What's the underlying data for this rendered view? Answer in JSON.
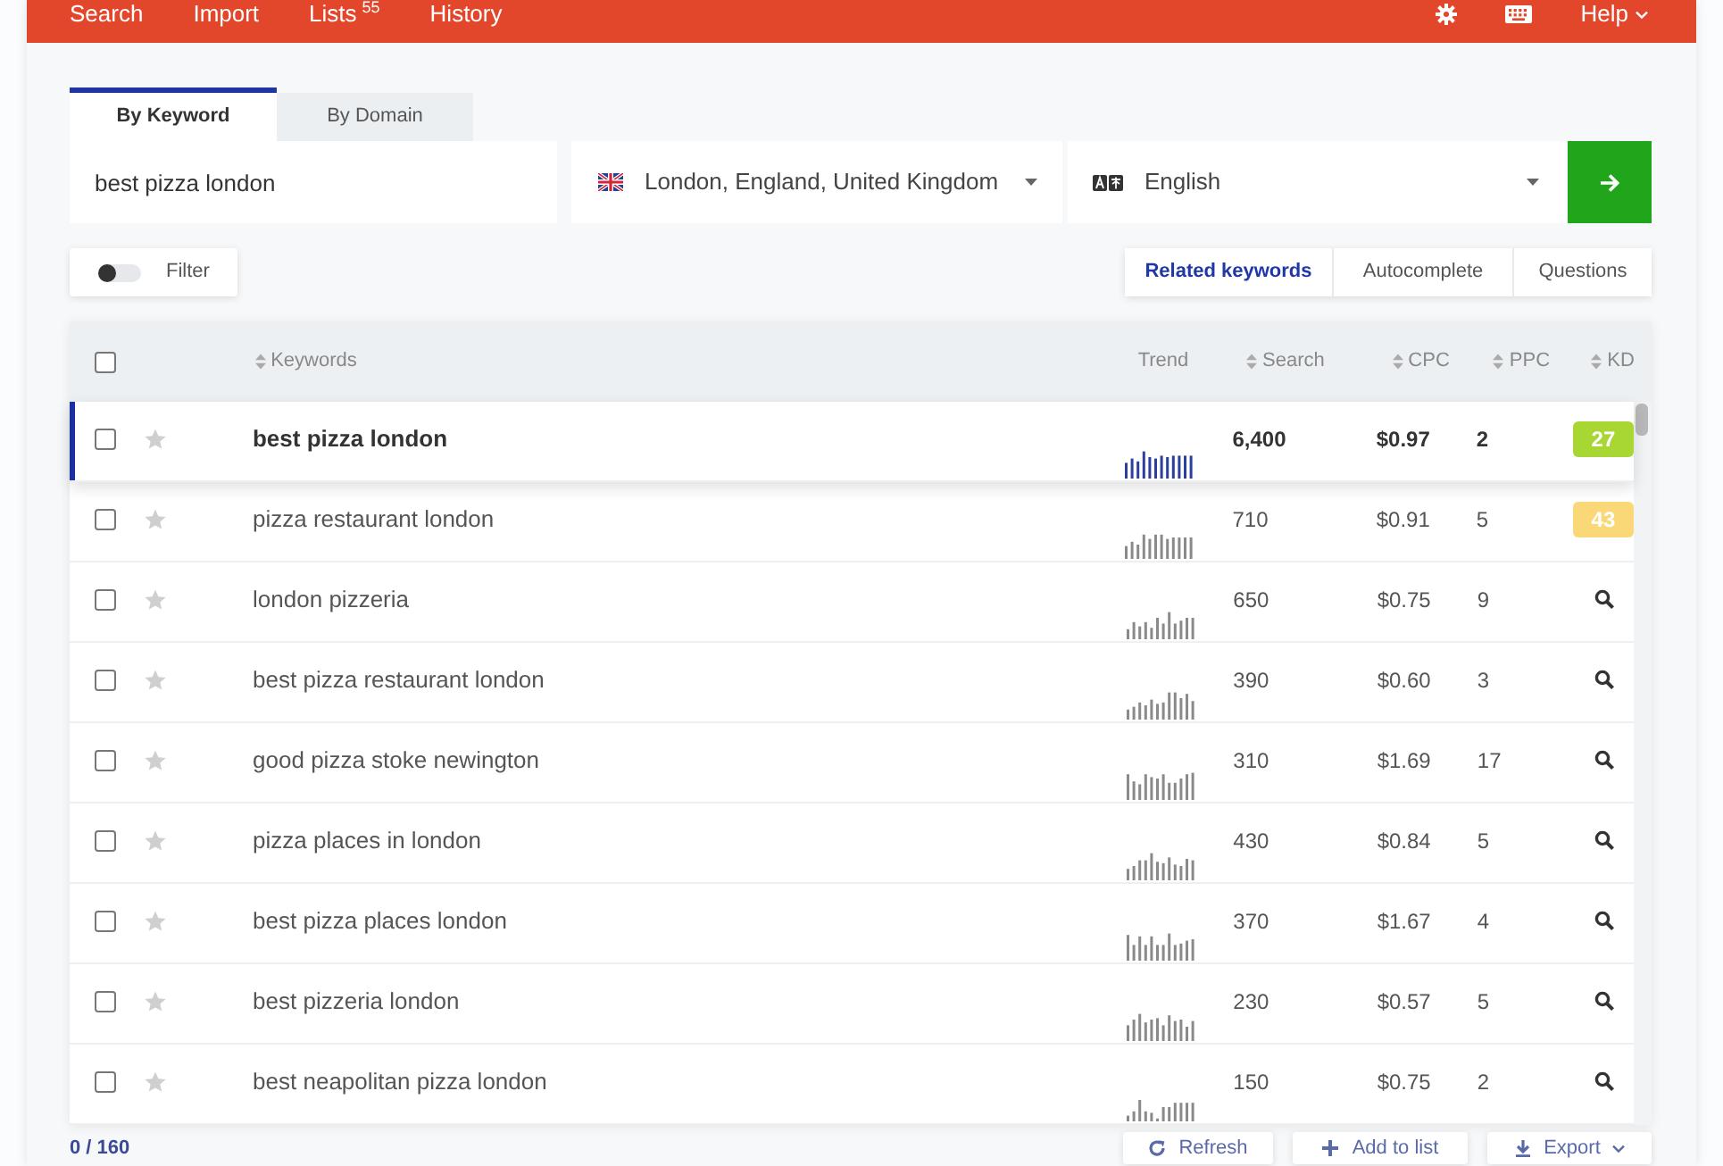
{
  "top_nav": {
    "links": [
      {
        "label": "Search"
      },
      {
        "label": "Import"
      },
      {
        "label": "Lists",
        "count": "55"
      },
      {
        "label": "History"
      }
    ],
    "help": {
      "label": "Help"
    }
  },
  "search_tabs": [
    {
      "label": "By Keyword",
      "selected": true
    },
    {
      "label": "By Domain",
      "selected": false
    }
  ],
  "query": {
    "value": "best pizza london"
  },
  "location": {
    "value": "London, England, United Kingdom"
  },
  "language": {
    "value": "English"
  },
  "filter": {
    "label": "Filter",
    "on": false
  },
  "modes": [
    {
      "label": "Related keywords",
      "selected": true
    },
    {
      "label": "Autocomplete",
      "selected": false
    },
    {
      "label": "Questions",
      "selected": false
    }
  ],
  "table": {
    "header_checked": false,
    "columns": [
      {
        "label": "Keywords",
        "sortable": true
      },
      {
        "label": "Trend",
        "sortable": false
      },
      {
        "label": "Search",
        "sortable": true
      },
      {
        "label": "CPC",
        "sortable": true
      },
      {
        "label": "PPC",
        "sortable": true
      },
      {
        "label": "KD",
        "sortable": true
      }
    ],
    "rows": [
      {
        "keyword": "best pizza london",
        "search": "6,400",
        "cpc": "$0.97",
        "ppc": "2",
        "kd": {
          "kind": "score",
          "value": "27",
          "color": "#a8d632"
        },
        "selected": true,
        "checked": false,
        "starred": false
      },
      {
        "keyword": "pizza restaurant london",
        "search": "710",
        "cpc": "$0.91",
        "ppc": "5",
        "kd": {
          "kind": "score",
          "value": "43",
          "color": "#fad877"
        },
        "selected": false,
        "checked": false,
        "starred": false
      },
      {
        "keyword": "london pizzeria",
        "search": "650",
        "cpc": "$0.75",
        "ppc": "9",
        "kd": {
          "kind": "lookup"
        },
        "selected": false,
        "checked": false,
        "starred": false
      },
      {
        "keyword": "best pizza restaurant london",
        "search": "390",
        "cpc": "$0.60",
        "ppc": "3",
        "kd": {
          "kind": "lookup"
        },
        "selected": false,
        "checked": false,
        "starred": false
      },
      {
        "keyword": "good pizza stoke newington",
        "search": "310",
        "cpc": "$1.69",
        "ppc": "17",
        "kd": {
          "kind": "lookup"
        },
        "selected": false,
        "checked": false,
        "starred": false
      },
      {
        "keyword": "pizza places in london",
        "search": "430",
        "cpc": "$0.84",
        "ppc": "5",
        "kd": {
          "kind": "lookup"
        },
        "selected": false,
        "checked": false,
        "starred": false
      },
      {
        "keyword": "best pizza places london",
        "search": "370",
        "cpc": "$1.67",
        "ppc": "4",
        "kd": {
          "kind": "lookup"
        },
        "selected": false,
        "checked": false,
        "starred": false
      },
      {
        "keyword": "best pizzeria london",
        "search": "230",
        "cpc": "$0.57",
        "ppc": "5",
        "kd": {
          "kind": "lookup"
        },
        "selected": false,
        "checked": false,
        "starred": false
      },
      {
        "keyword": "best neapolitan pizza london",
        "search": "150",
        "cpc": "$0.75",
        "ppc": "2",
        "kd": {
          "kind": "lookup"
        },
        "selected": false,
        "checked": false,
        "starred": false
      }
    ]
  },
  "footer": {
    "selection": "0 / 160",
    "buttons": [
      {
        "label": "Refresh",
        "kind": "refresh",
        "menu": false
      },
      {
        "label": "Add to list",
        "kind": "add",
        "menu": false
      },
      {
        "label": "Export",
        "kind": "export",
        "menu": true
      }
    ]
  }
}
